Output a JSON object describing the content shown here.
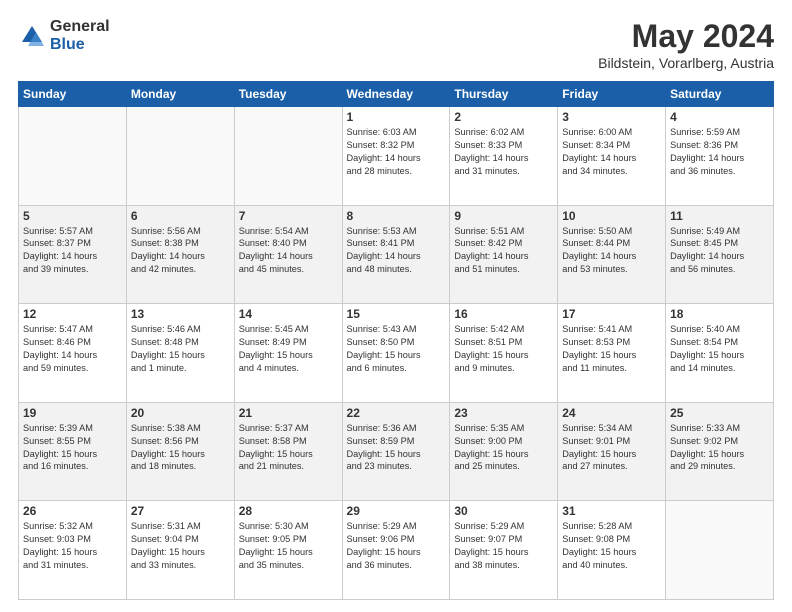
{
  "logo": {
    "general": "General",
    "blue": "Blue"
  },
  "title": "May 2024",
  "location": "Bildstein, Vorarlberg, Austria",
  "days_header": [
    "Sunday",
    "Monday",
    "Tuesday",
    "Wednesday",
    "Thursday",
    "Friday",
    "Saturday"
  ],
  "weeks": [
    [
      {
        "day": "",
        "info": ""
      },
      {
        "day": "",
        "info": ""
      },
      {
        "day": "",
        "info": ""
      },
      {
        "day": "1",
        "info": "Sunrise: 6:03 AM\nSunset: 8:32 PM\nDaylight: 14 hours\nand 28 minutes."
      },
      {
        "day": "2",
        "info": "Sunrise: 6:02 AM\nSunset: 8:33 PM\nDaylight: 14 hours\nand 31 minutes."
      },
      {
        "day": "3",
        "info": "Sunrise: 6:00 AM\nSunset: 8:34 PM\nDaylight: 14 hours\nand 34 minutes."
      },
      {
        "day": "4",
        "info": "Sunrise: 5:59 AM\nSunset: 8:36 PM\nDaylight: 14 hours\nand 36 minutes."
      }
    ],
    [
      {
        "day": "5",
        "info": "Sunrise: 5:57 AM\nSunset: 8:37 PM\nDaylight: 14 hours\nand 39 minutes."
      },
      {
        "day": "6",
        "info": "Sunrise: 5:56 AM\nSunset: 8:38 PM\nDaylight: 14 hours\nand 42 minutes."
      },
      {
        "day": "7",
        "info": "Sunrise: 5:54 AM\nSunset: 8:40 PM\nDaylight: 14 hours\nand 45 minutes."
      },
      {
        "day": "8",
        "info": "Sunrise: 5:53 AM\nSunset: 8:41 PM\nDaylight: 14 hours\nand 48 minutes."
      },
      {
        "day": "9",
        "info": "Sunrise: 5:51 AM\nSunset: 8:42 PM\nDaylight: 14 hours\nand 51 minutes."
      },
      {
        "day": "10",
        "info": "Sunrise: 5:50 AM\nSunset: 8:44 PM\nDaylight: 14 hours\nand 53 minutes."
      },
      {
        "day": "11",
        "info": "Sunrise: 5:49 AM\nSunset: 8:45 PM\nDaylight: 14 hours\nand 56 minutes."
      }
    ],
    [
      {
        "day": "12",
        "info": "Sunrise: 5:47 AM\nSunset: 8:46 PM\nDaylight: 14 hours\nand 59 minutes."
      },
      {
        "day": "13",
        "info": "Sunrise: 5:46 AM\nSunset: 8:48 PM\nDaylight: 15 hours\nand 1 minute."
      },
      {
        "day": "14",
        "info": "Sunrise: 5:45 AM\nSunset: 8:49 PM\nDaylight: 15 hours\nand 4 minutes."
      },
      {
        "day": "15",
        "info": "Sunrise: 5:43 AM\nSunset: 8:50 PM\nDaylight: 15 hours\nand 6 minutes."
      },
      {
        "day": "16",
        "info": "Sunrise: 5:42 AM\nSunset: 8:51 PM\nDaylight: 15 hours\nand 9 minutes."
      },
      {
        "day": "17",
        "info": "Sunrise: 5:41 AM\nSunset: 8:53 PM\nDaylight: 15 hours\nand 11 minutes."
      },
      {
        "day": "18",
        "info": "Sunrise: 5:40 AM\nSunset: 8:54 PM\nDaylight: 15 hours\nand 14 minutes."
      }
    ],
    [
      {
        "day": "19",
        "info": "Sunrise: 5:39 AM\nSunset: 8:55 PM\nDaylight: 15 hours\nand 16 minutes."
      },
      {
        "day": "20",
        "info": "Sunrise: 5:38 AM\nSunset: 8:56 PM\nDaylight: 15 hours\nand 18 minutes."
      },
      {
        "day": "21",
        "info": "Sunrise: 5:37 AM\nSunset: 8:58 PM\nDaylight: 15 hours\nand 21 minutes."
      },
      {
        "day": "22",
        "info": "Sunrise: 5:36 AM\nSunset: 8:59 PM\nDaylight: 15 hours\nand 23 minutes."
      },
      {
        "day": "23",
        "info": "Sunrise: 5:35 AM\nSunset: 9:00 PM\nDaylight: 15 hours\nand 25 minutes."
      },
      {
        "day": "24",
        "info": "Sunrise: 5:34 AM\nSunset: 9:01 PM\nDaylight: 15 hours\nand 27 minutes."
      },
      {
        "day": "25",
        "info": "Sunrise: 5:33 AM\nSunset: 9:02 PM\nDaylight: 15 hours\nand 29 minutes."
      }
    ],
    [
      {
        "day": "26",
        "info": "Sunrise: 5:32 AM\nSunset: 9:03 PM\nDaylight: 15 hours\nand 31 minutes."
      },
      {
        "day": "27",
        "info": "Sunrise: 5:31 AM\nSunset: 9:04 PM\nDaylight: 15 hours\nand 33 minutes."
      },
      {
        "day": "28",
        "info": "Sunrise: 5:30 AM\nSunset: 9:05 PM\nDaylight: 15 hours\nand 35 minutes."
      },
      {
        "day": "29",
        "info": "Sunrise: 5:29 AM\nSunset: 9:06 PM\nDaylight: 15 hours\nand 36 minutes."
      },
      {
        "day": "30",
        "info": "Sunrise: 5:29 AM\nSunset: 9:07 PM\nDaylight: 15 hours\nand 38 minutes."
      },
      {
        "day": "31",
        "info": "Sunrise: 5:28 AM\nSunset: 9:08 PM\nDaylight: 15 hours\nand 40 minutes."
      },
      {
        "day": "",
        "info": ""
      }
    ]
  ]
}
